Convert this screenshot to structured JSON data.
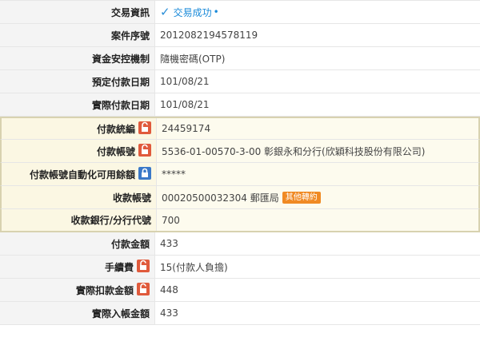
{
  "rows": [
    {
      "label": "交易資訊",
      "value": "交易成功",
      "suffix": "•"
    },
    {
      "label": "案件序號",
      "value": "2012082194578119"
    },
    {
      "label": "資金安控機制",
      "value": "隨機密碼(OTP)"
    },
    {
      "label": "預定付款日期",
      "value": "101/08/21"
    },
    {
      "label": "實際付款日期",
      "value": "101/08/21"
    },
    {
      "label": "付款統編",
      "value": "24459174"
    },
    {
      "label": "付款帳號",
      "value": "5536-01-00570-3-00 彰銀永和分行(欣穎科技股份有限公司)"
    },
    {
      "label": "付款帳號自動化可用餘額",
      "value": "*****"
    },
    {
      "label": "收款帳號",
      "value": "00020500032304 郵匯局",
      "badge": "其他轉約"
    },
    {
      "label": "收款銀行/分行代號",
      "value": "700"
    },
    {
      "label": "付款金額",
      "value": "433"
    },
    {
      "label": "手續費",
      "value": "15(付款人負擔)"
    },
    {
      "label": "實際扣款金額",
      "value": "448"
    },
    {
      "label": "實際入帳金額",
      "value": "433"
    }
  ],
  "colors": {
    "accent": "#1a8ad9",
    "icon_red": "#e05a3c",
    "icon_blue": "#3a78c8",
    "badge": "#f08a24"
  },
  "icons": {
    "unlock": "unlock-icon",
    "lock": "lock-icon",
    "check": "check-icon"
  }
}
